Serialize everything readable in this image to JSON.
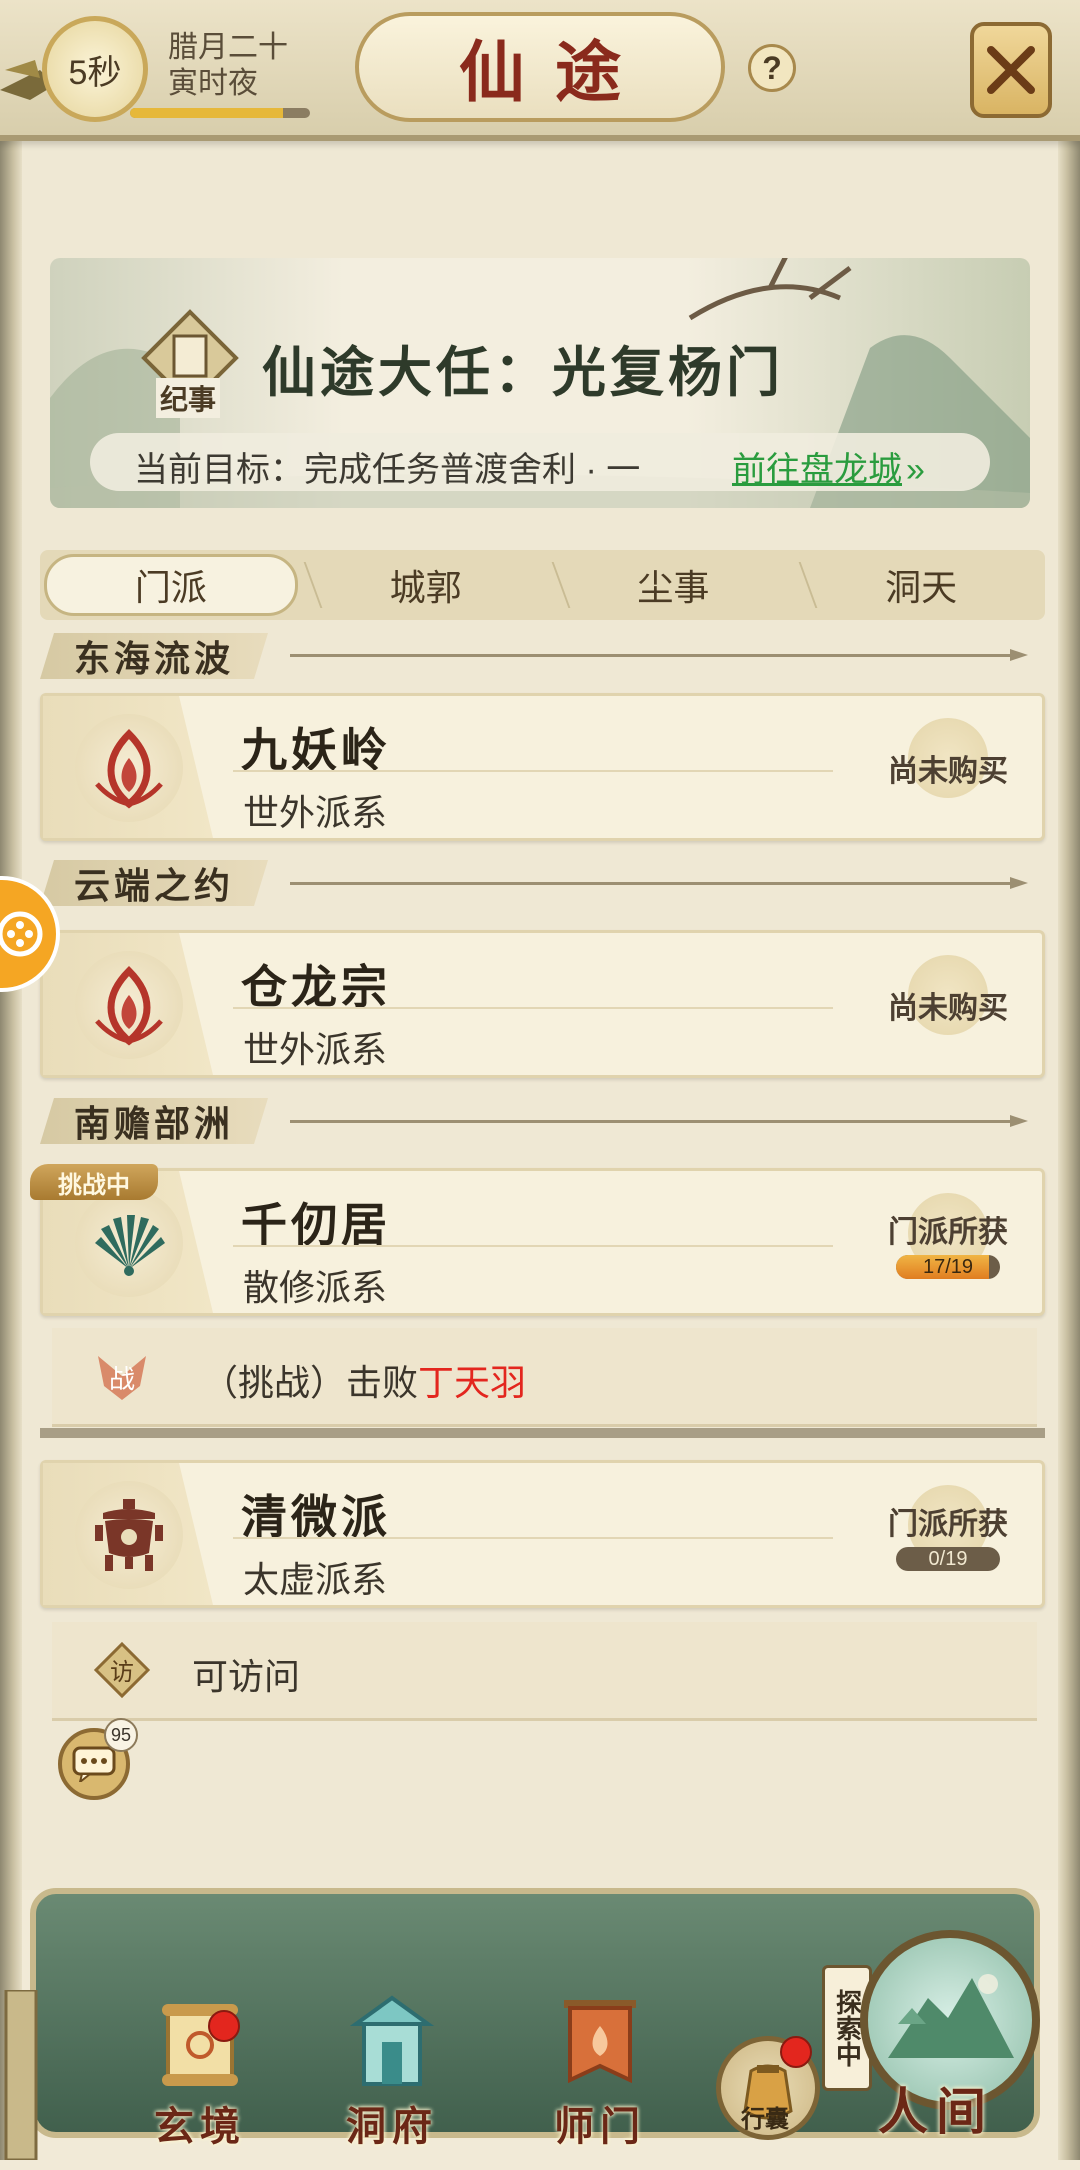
{
  "header": {
    "timer": "5秒",
    "date_line1": "腊月二十",
    "date_line2": "寅时夜",
    "time_progress": 0.85,
    "title": "仙途",
    "help": "?"
  },
  "quest": {
    "badge": "纪事",
    "title": "仙途大任：光复杨门",
    "goal_label": "当前目标：完成任务普渡舍利 · 一",
    "goal_link": "前往盘龙城"
  },
  "tabs": [
    "门派",
    "城郭",
    "尘事",
    "洞天"
  ],
  "sections": [
    {
      "title": "东海流波"
    },
    {
      "title": "云端之约"
    },
    {
      "title": "南赡部洲"
    }
  ],
  "sects": [
    {
      "name": "九妖岭",
      "type": "世外派系",
      "status": "尚未购买"
    },
    {
      "name": "仓龙宗",
      "type": "世外派系",
      "status": "尚未购买"
    },
    {
      "name": "千仞居",
      "type": "散修派系",
      "status": "门派所获",
      "progress": "17/19",
      "tag": "挑战中",
      "task_prefix": "（挑战）击败",
      "task_target": "丁天羽",
      "task_icon_text": "战"
    },
    {
      "name": "清微派",
      "type": "太虚派系",
      "status": "门派所获",
      "progress": "0/19",
      "task_text": "可访问",
      "task_icon_text": "访"
    }
  ],
  "chat_count": "95",
  "nav": {
    "xuanjing": "玄境",
    "dongfu": "洞府",
    "shimen": "师门",
    "bag": "行囊",
    "explore": "探索中",
    "renjian": "人间"
  },
  "colors": {
    "accent_red": "#e3261e",
    "link_green": "#2a9c3e",
    "title_red": "#8a2a1c"
  }
}
